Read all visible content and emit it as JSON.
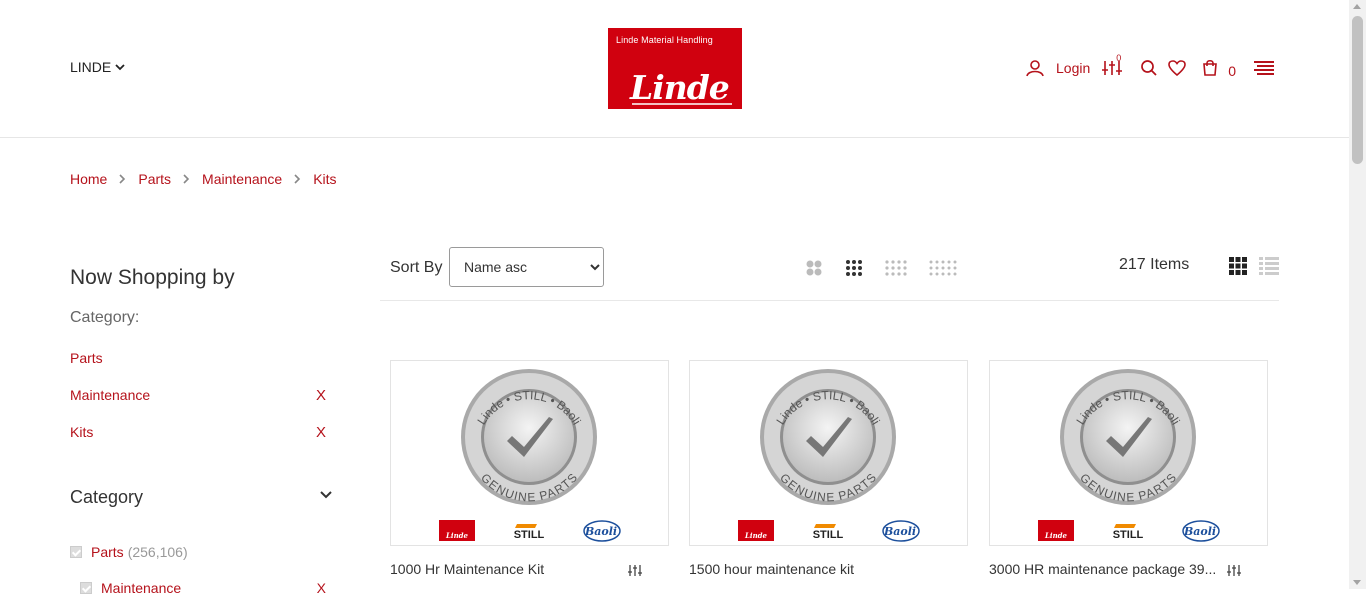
{
  "header": {
    "store_switcher": "LINDE",
    "logo": {
      "top_text": "Linde Material Handling",
      "brand_text": "Linde"
    },
    "login_label": "Login",
    "compare_count": "0",
    "cart_count": "0"
  },
  "breadcrumb": [
    "Home",
    "Parts",
    "Maintenance",
    "Kits"
  ],
  "sidebar": {
    "title": "Now Shopping by",
    "category_label": "Category:",
    "active_filters": [
      {
        "label": "Parts",
        "removable": false
      },
      {
        "label": "Maintenance",
        "removable": true,
        "remove_label": "X"
      },
      {
        "label": "Kits",
        "removable": true,
        "remove_label": "X"
      }
    ],
    "category_section_title": "Category",
    "categories": [
      {
        "label": "Parts",
        "count": "(256,106)"
      },
      {
        "label": "Maintenance",
        "count": "",
        "remove_label": "X"
      }
    ]
  },
  "toolbar": {
    "sort_label": "Sort By",
    "sort_selected": "Name asc",
    "item_count": "217 Items",
    "grid_options": [
      "grid-2",
      "grid-3",
      "grid-4",
      "grid-5"
    ],
    "active_grid": "grid-3",
    "view_modes": [
      "grid",
      "list"
    ],
    "active_view": "grid"
  },
  "products": [
    {
      "name": "1000 Hr Maintenance Kit",
      "has_compare": true
    },
    {
      "name": "1500 hour maintenance kit",
      "has_compare": false
    },
    {
      "name": "3000 HR maintenance package 39...",
      "has_compare": true
    }
  ],
  "genuine_seal": {
    "top": "Linde • STILL • Baoli",
    "bottom": "GENUINE PARTS",
    "brands": [
      "Linde",
      "STILL",
      "Baoli"
    ]
  },
  "colors": {
    "accent": "#b5121b",
    "linde_red": "#d0010f",
    "still_orange": "#f08a00",
    "baoli_blue": "#1c4f9c"
  }
}
